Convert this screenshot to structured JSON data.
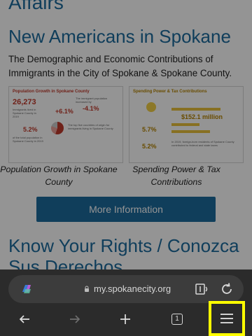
{
  "page": {
    "section_above": "Affairs",
    "heading": "New Americans in Spokane",
    "intro": "The Demographic and Economic Contributions of Immigrants in the City of Spokane & Spokane County.",
    "cards": [
      {
        "title": "Population Growth in Spokane County",
        "stat_1": "26,273",
        "stat_2": "+6.1%",
        "stat_3": "-4.1%",
        "stat_4": "5.2%",
        "caption": "Population Growth in Spokane County"
      },
      {
        "title": "Spending Power & Tax Contributions",
        "stat_1": "$152.1 million",
        "stat_2": "5.7%",
        "stat_3": "5.2%",
        "caption": "Spending Power & Tax Contributions"
      }
    ],
    "button": "More Information",
    "heading2": "Know Your Rights / Conozca Sus Derechos"
  },
  "toolbar": {
    "url": "my.spokanecity.org",
    "tab_count": "1"
  },
  "colors": {
    "link_blue": "#1d6b9e",
    "toolbar_bg": "#2b2b2b",
    "highlight": "#ffff00"
  }
}
